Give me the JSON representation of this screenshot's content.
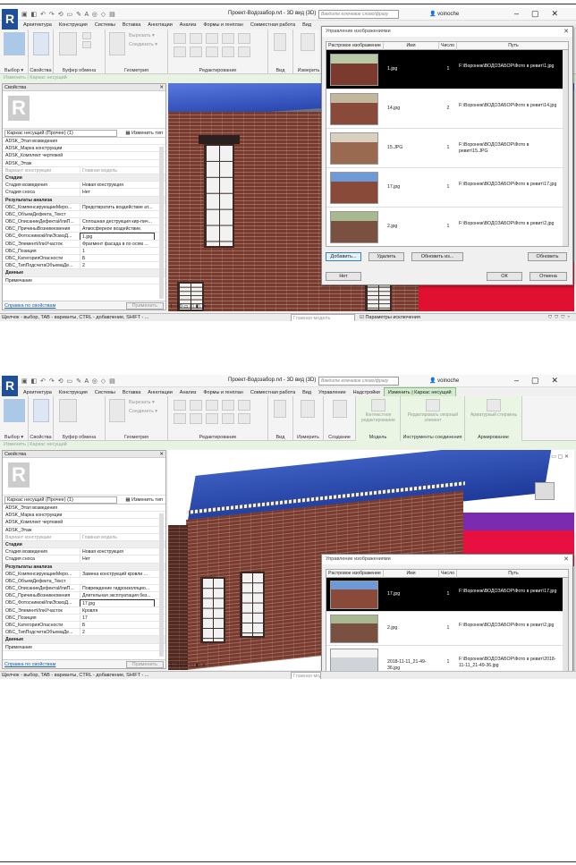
{
  "screens": [
    {
      "doc_title": "Проект-Водозабор.rvt - 3D вид (3D)",
      "search_placeholder": "Введите ключевое слово/фразу",
      "user": "voinoche",
      "tabs": [
        "Архитектура",
        "Конструкция",
        "Системы",
        "Вставка",
        "Аннотации",
        "Анализ",
        "Формы и генплан",
        "Совместная работа",
        "Вид"
      ],
      "ribbon": {
        "select": "Выбор ▾",
        "props": "Свойства",
        "clipboard": "Буфер обмена",
        "geometry": "Геометрия",
        "modify": "Редактирование",
        "view": "Вид",
        "measure": "Измерить",
        "cut": "Вырезать ▾",
        "join": "Соединить ▾",
        "paste": "Вставить",
        "modify_btn": "Изменить"
      },
      "context_bar": "Изменить | Каркас несущий",
      "properties": {
        "title": "Свойства",
        "type": "Каркас несущий (Прочее) (1)",
        "edit_type": "Изменить тип",
        "rows": [
          {
            "k": "ADSK_Этап возведения",
            "v": ""
          },
          {
            "k": "ADSK_Марка конструкции",
            "v": ""
          },
          {
            "k": "ADSK_Комплект чертежей",
            "v": ""
          },
          {
            "k": "ADSK_Этаж",
            "v": ""
          },
          {
            "k": "Вариант конструкции",
            "v": "Главная модель",
            "grey": true
          },
          {
            "k": "Стадии",
            "v": "",
            "sec": true
          },
          {
            "k": "Стадия возведения",
            "v": "Новая конструкция"
          },
          {
            "k": "Стадия сноса",
            "v": "Нет"
          },
          {
            "k": "Результаты анализа",
            "v": "",
            "sec": true
          },
          {
            "k": "ОБС_КомпенсирующиеМеро...",
            "v": "Предотвратить воздействие ат..."
          },
          {
            "k": "ОБС_ОбъемДефекта_Текст",
            "v": ""
          },
          {
            "k": "ОБС_ОписаниеДефектаИлиП...",
            "v": "Сплошная деструкция кир-пич..."
          },
          {
            "k": "ОБС_ПричиныВозникновения",
            "v": "Атмосферное воздействие."
          },
          {
            "k": "ОБС_ФотоснимокИлиЭскизД...",
            "v": "1.jpg",
            "hl": true
          },
          {
            "k": "ОБС_ЭлементИлиУчасток",
            "v": "Фрагмент фасада в по осям ..."
          },
          {
            "k": "ОБС_Позиция",
            "v": "1"
          },
          {
            "k": "ОБС_КатегорияОпасности",
            "v": "Б"
          },
          {
            "k": "ОБС_ТипПодсчетаОбъемаДе...",
            "v": "2"
          },
          {
            "k": "Данные",
            "v": "",
            "sec": true
          },
          {
            "k": "Примечание",
            "v": ""
          }
        ],
        "link": "Справка по свойствам",
        "apply": "Применить"
      },
      "scale": "1 : 50",
      "status": "Щелчок - выбор, TAB - варианты, CTRL - добавление, SHIFT - ...",
      "model_field": "Главная модель",
      "exclusions": "Параметры исключения",
      "dialog": {
        "title": "Управление изображениями",
        "cols": [
          "Растровое изображение",
          "Имя",
          "Число",
          "Путь"
        ],
        "rows": [
          {
            "name": "1.jpg",
            "count": "1",
            "path": "F:\\Воронеж\\ВОДОЗАБОР\\Фото в ревит\\1.jpg",
            "sel": true
          },
          {
            "name": "14.jpg",
            "count": "2",
            "path": "F:\\Воронеж\\ВОДОЗАБОР\\Фото в ревит\\14.jpg"
          },
          {
            "name": "15.JPG",
            "count": "1",
            "path": "F:\\Воронеж\\ВОДОЗАБОР\\Фото в ревит\\15.JPG"
          },
          {
            "name": "17.jpg",
            "count": "1",
            "path": "F:\\Воронеж\\ВОДОЗАБОР\\Фото в ревит\\17.jpg"
          },
          {
            "name": "2.jpg",
            "count": "1",
            "path": "F:\\Воронеж\\ВОДОЗАБОР\\Фото в ревит\\2.jpg"
          }
        ],
        "add": "Добавить...",
        "delete": "Удалить",
        "reload": "Обновить из...",
        "refresh": "Обновить",
        "no": "Нет",
        "ok": "ОК",
        "cancel": "Отмена"
      }
    },
    {
      "doc_title": "Проект-Водозабор.rvt - 3D вид (3D)",
      "search_placeholder": "Введите ключевое слово/фразу",
      "user": "voinoche",
      "tabs": [
        "Архитектура",
        "Конструкция",
        "Системы",
        "Вставка",
        "Аннотации",
        "Анализ",
        "Формы и генплан",
        "Совместная работа",
        "Вид",
        "Управление",
        "Надстройки",
        "Изменить | Каркас несущий"
      ],
      "ribbon": {
        "select": "Выбор ▾",
        "props": "Свойства",
        "clipboard": "Буфер обмена",
        "geometry": "Геометрия",
        "modify": "Редактирование",
        "view": "Вид",
        "measure": "Измерить",
        "create": "Создание",
        "model": "Модель",
        "tools": "Инструменты соединения",
        "rebar": "Армирование",
        "edit_profile": "Контекстное редактирование",
        "edit_support": "Редактировать опорный элемент",
        "rebar_btn": "Арматурный стержень",
        "cut": "Вырезать ▾",
        "join": "Соединить ▾",
        "paste": "Вставить",
        "modify_btn": "Изменить"
      },
      "context_bar": "Изменить | Каркас несущий",
      "properties": {
        "title": "Свойства",
        "type": "Каркас несущий (Прочее) (1)",
        "edit_type": "Изменить тип",
        "rows": [
          {
            "k": "ADSK_Этап возведения",
            "v": ""
          },
          {
            "k": "ADSK_Марка конструкции",
            "v": ""
          },
          {
            "k": "ADSK_Комплект чертежей",
            "v": ""
          },
          {
            "k": "ADSK_Этаж",
            "v": ""
          },
          {
            "k": "Вариант конструкции",
            "v": "Главная модель",
            "grey": true
          },
          {
            "k": "Стадии",
            "v": "",
            "sec": true
          },
          {
            "k": "Стадия возведения",
            "v": "Новая конструкция"
          },
          {
            "k": "Стадия сноса",
            "v": "Нет"
          },
          {
            "k": "Результаты анализа",
            "v": "",
            "sec": true
          },
          {
            "k": "ОБС_КомпенсирующиеМеро...",
            "v": "Замена конструкций кровли ..."
          },
          {
            "k": "ОБС_ОбъемДефекта_Текст",
            "v": ""
          },
          {
            "k": "ОБС_ОписаниеДефектаИлиП...",
            "v": "Повреждение гидроизоляцио..."
          },
          {
            "k": "ОБС_ПричиныВозникновения",
            "v": "Длительная эксплуатация без..."
          },
          {
            "k": "ОБС_ФотоснимокИлиЭскизД...",
            "v": "17.jpg",
            "hl": true
          },
          {
            "k": "ОБС_ЭлементИлиУчасток",
            "v": "Кровля"
          },
          {
            "k": "ОБС_Позиция",
            "v": "17"
          },
          {
            "k": "ОБС_КатегорияОпасности",
            "v": "Б"
          },
          {
            "k": "ОБС_ТипПодсчетаОбъемаДе...",
            "v": "2"
          },
          {
            "k": "Данные",
            "v": "",
            "sec": true
          },
          {
            "k": "Примечание",
            "v": ""
          }
        ],
        "link": "Справка по свойствам",
        "apply": "Применить"
      },
      "scale": "1 : 50",
      "status": "Щелчок - выбор, TAB - варианты, CTRL - добавление, SHIFT - ...",
      "model_field": "Главная модель",
      "dialog": {
        "title": "Управление изображениями",
        "cols": [
          "Растровое изображение",
          "Имя",
          "Число",
          "Путь"
        ],
        "rows": [
          {
            "name": "17.jpg",
            "count": "1",
            "path": "F:\\Воронеж\\ВОДОЗАБОР\\Фото в ревит\\17.jpg",
            "sel": true
          },
          {
            "name": "2.jpg",
            "count": "1",
            "path": "F:\\Воронеж\\ВОДОЗАБОР\\Фото в ревит\\2.jpg"
          },
          {
            "name": "2018-11-11_21-49-36.jpg",
            "count": "1",
            "path": "F:\\Воронеж\\ВОДОЗАБОР\\Фото в ревит\\2018-11-11_21-49-36.jpg"
          }
        ]
      }
    }
  ]
}
